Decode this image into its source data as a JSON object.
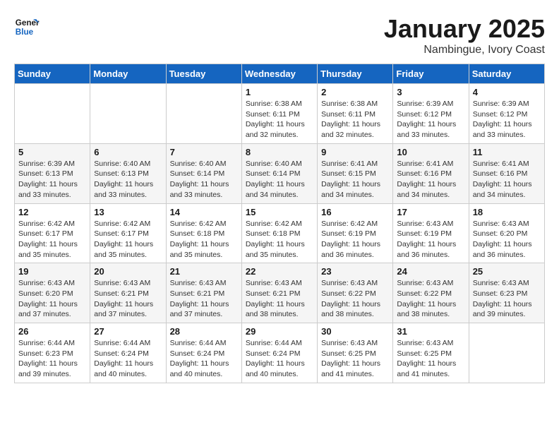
{
  "header": {
    "logo_line1": "General",
    "logo_line2": "Blue",
    "month": "January 2025",
    "location": "Nambingue, Ivory Coast"
  },
  "weekdays": [
    "Sunday",
    "Monday",
    "Tuesday",
    "Wednesday",
    "Thursday",
    "Friday",
    "Saturday"
  ],
  "weeks": [
    [
      {
        "day": "",
        "info": ""
      },
      {
        "day": "",
        "info": ""
      },
      {
        "day": "",
        "info": ""
      },
      {
        "day": "1",
        "info": "Sunrise: 6:38 AM\nSunset: 6:11 PM\nDaylight: 11 hours\nand 32 minutes."
      },
      {
        "day": "2",
        "info": "Sunrise: 6:38 AM\nSunset: 6:11 PM\nDaylight: 11 hours\nand 32 minutes."
      },
      {
        "day": "3",
        "info": "Sunrise: 6:39 AM\nSunset: 6:12 PM\nDaylight: 11 hours\nand 33 minutes."
      },
      {
        "day": "4",
        "info": "Sunrise: 6:39 AM\nSunset: 6:12 PM\nDaylight: 11 hours\nand 33 minutes."
      }
    ],
    [
      {
        "day": "5",
        "info": "Sunrise: 6:39 AM\nSunset: 6:13 PM\nDaylight: 11 hours\nand 33 minutes."
      },
      {
        "day": "6",
        "info": "Sunrise: 6:40 AM\nSunset: 6:13 PM\nDaylight: 11 hours\nand 33 minutes."
      },
      {
        "day": "7",
        "info": "Sunrise: 6:40 AM\nSunset: 6:14 PM\nDaylight: 11 hours\nand 33 minutes."
      },
      {
        "day": "8",
        "info": "Sunrise: 6:40 AM\nSunset: 6:14 PM\nDaylight: 11 hours\nand 34 minutes."
      },
      {
        "day": "9",
        "info": "Sunrise: 6:41 AM\nSunset: 6:15 PM\nDaylight: 11 hours\nand 34 minutes."
      },
      {
        "day": "10",
        "info": "Sunrise: 6:41 AM\nSunset: 6:16 PM\nDaylight: 11 hours\nand 34 minutes."
      },
      {
        "day": "11",
        "info": "Sunrise: 6:41 AM\nSunset: 6:16 PM\nDaylight: 11 hours\nand 34 minutes."
      }
    ],
    [
      {
        "day": "12",
        "info": "Sunrise: 6:42 AM\nSunset: 6:17 PM\nDaylight: 11 hours\nand 35 minutes."
      },
      {
        "day": "13",
        "info": "Sunrise: 6:42 AM\nSunset: 6:17 PM\nDaylight: 11 hours\nand 35 minutes."
      },
      {
        "day": "14",
        "info": "Sunrise: 6:42 AM\nSunset: 6:18 PM\nDaylight: 11 hours\nand 35 minutes."
      },
      {
        "day": "15",
        "info": "Sunrise: 6:42 AM\nSunset: 6:18 PM\nDaylight: 11 hours\nand 35 minutes."
      },
      {
        "day": "16",
        "info": "Sunrise: 6:42 AM\nSunset: 6:19 PM\nDaylight: 11 hours\nand 36 minutes."
      },
      {
        "day": "17",
        "info": "Sunrise: 6:43 AM\nSunset: 6:19 PM\nDaylight: 11 hours\nand 36 minutes."
      },
      {
        "day": "18",
        "info": "Sunrise: 6:43 AM\nSunset: 6:20 PM\nDaylight: 11 hours\nand 36 minutes."
      }
    ],
    [
      {
        "day": "19",
        "info": "Sunrise: 6:43 AM\nSunset: 6:20 PM\nDaylight: 11 hours\nand 37 minutes."
      },
      {
        "day": "20",
        "info": "Sunrise: 6:43 AM\nSunset: 6:21 PM\nDaylight: 11 hours\nand 37 minutes."
      },
      {
        "day": "21",
        "info": "Sunrise: 6:43 AM\nSunset: 6:21 PM\nDaylight: 11 hours\nand 37 minutes."
      },
      {
        "day": "22",
        "info": "Sunrise: 6:43 AM\nSunset: 6:21 PM\nDaylight: 11 hours\nand 38 minutes."
      },
      {
        "day": "23",
        "info": "Sunrise: 6:43 AM\nSunset: 6:22 PM\nDaylight: 11 hours\nand 38 minutes."
      },
      {
        "day": "24",
        "info": "Sunrise: 6:43 AM\nSunset: 6:22 PM\nDaylight: 11 hours\nand 38 minutes."
      },
      {
        "day": "25",
        "info": "Sunrise: 6:43 AM\nSunset: 6:23 PM\nDaylight: 11 hours\nand 39 minutes."
      }
    ],
    [
      {
        "day": "26",
        "info": "Sunrise: 6:44 AM\nSunset: 6:23 PM\nDaylight: 11 hours\nand 39 minutes."
      },
      {
        "day": "27",
        "info": "Sunrise: 6:44 AM\nSunset: 6:24 PM\nDaylight: 11 hours\nand 40 minutes."
      },
      {
        "day": "28",
        "info": "Sunrise: 6:44 AM\nSunset: 6:24 PM\nDaylight: 11 hours\nand 40 minutes."
      },
      {
        "day": "29",
        "info": "Sunrise: 6:44 AM\nSunset: 6:24 PM\nDaylight: 11 hours\nand 40 minutes."
      },
      {
        "day": "30",
        "info": "Sunrise: 6:43 AM\nSunset: 6:25 PM\nDaylight: 11 hours\nand 41 minutes."
      },
      {
        "day": "31",
        "info": "Sunrise: 6:43 AM\nSunset: 6:25 PM\nDaylight: 11 hours\nand 41 minutes."
      },
      {
        "day": "",
        "info": ""
      }
    ]
  ]
}
